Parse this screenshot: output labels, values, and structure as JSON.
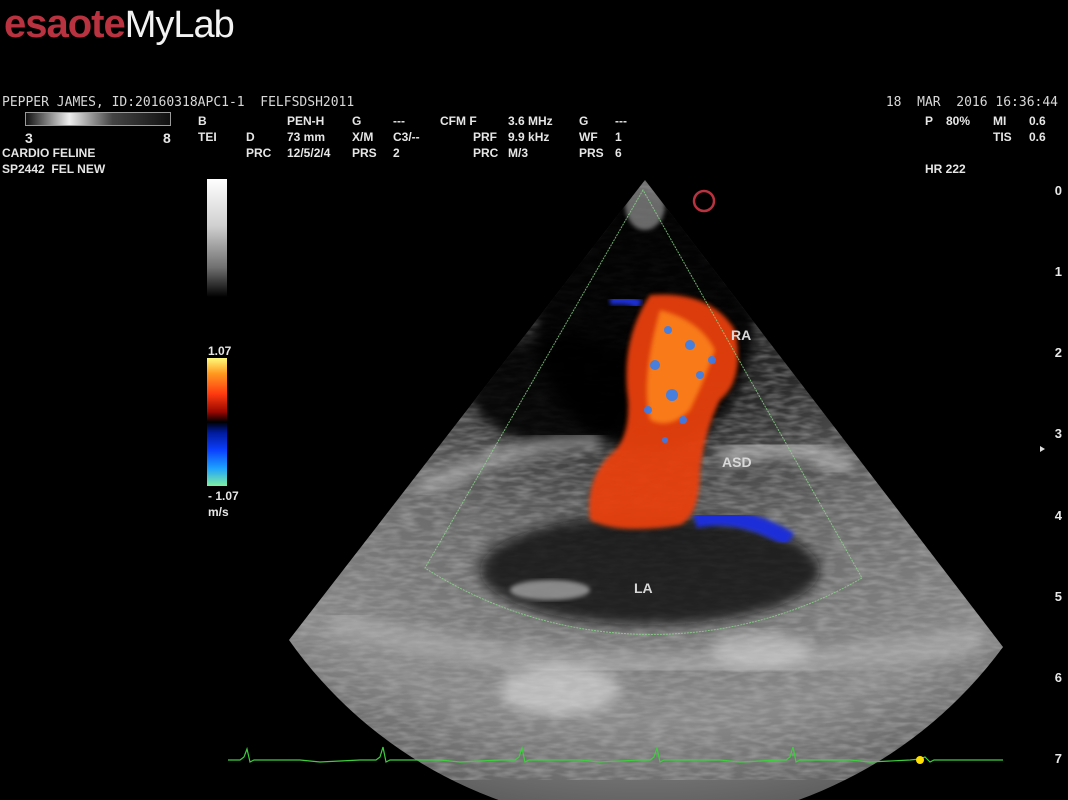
{
  "logo": {
    "brand": "esaote",
    "product": "MyLab"
  },
  "patient": {
    "line": "PEPPER JAMES, ID:20160318APC1-1  FELFSDSH2011",
    "preset": "CARDIO FELINE",
    "probe": "SP2442  FEL NEW"
  },
  "datetime": "18  MAR  2016 16:36:44",
  "gray_scale": {
    "min": "3",
    "max": "8"
  },
  "bmode": {
    "mode": "B",
    "mode2": "TEI",
    "d_label": "D",
    "d_value": "73 mm",
    "prc_label": "PRC",
    "prc_value": "12/5/2/4",
    "penh": "PEN-H",
    "g_label": "G",
    "g_value": "---",
    "xm_label": "X/M",
    "xm_value": "C3/--",
    "prs_label": "PRS",
    "prs_value": "2"
  },
  "cfm": {
    "label": "CFM F",
    "freq": "3.6 MHz",
    "prf_label": "PRF",
    "prf_value": "9.9 kHz",
    "prc_label": "PRC",
    "prc_value": "M/3",
    "g_label": "G",
    "g_value": "---",
    "wf_label": "WF",
    "wf_value": "1",
    "prs_label": "PRS",
    "prs_value": "6"
  },
  "power": {
    "p_label": "P",
    "p_value": "80%",
    "mi_label": "MI",
    "mi_value": "0.6",
    "tis_label": "TIS",
    "tis_value": "0.6"
  },
  "heart_rate": "HR 222",
  "velocity_scale": {
    "max": "1.07",
    "min": "- 1.07",
    "unit": "m/s"
  },
  "depth_marks": [
    "0",
    "1",
    "2",
    "3",
    "4",
    "5",
    "6",
    "7"
  ],
  "annotations": {
    "ra": "RA",
    "asd": "ASD",
    "la": "LA"
  },
  "colors": {
    "brand_red": "#b8323f",
    "ecg_green": "#3ccf3c",
    "marker_yellow": "#ffe000",
    "sector_border": "#8ad88a"
  }
}
